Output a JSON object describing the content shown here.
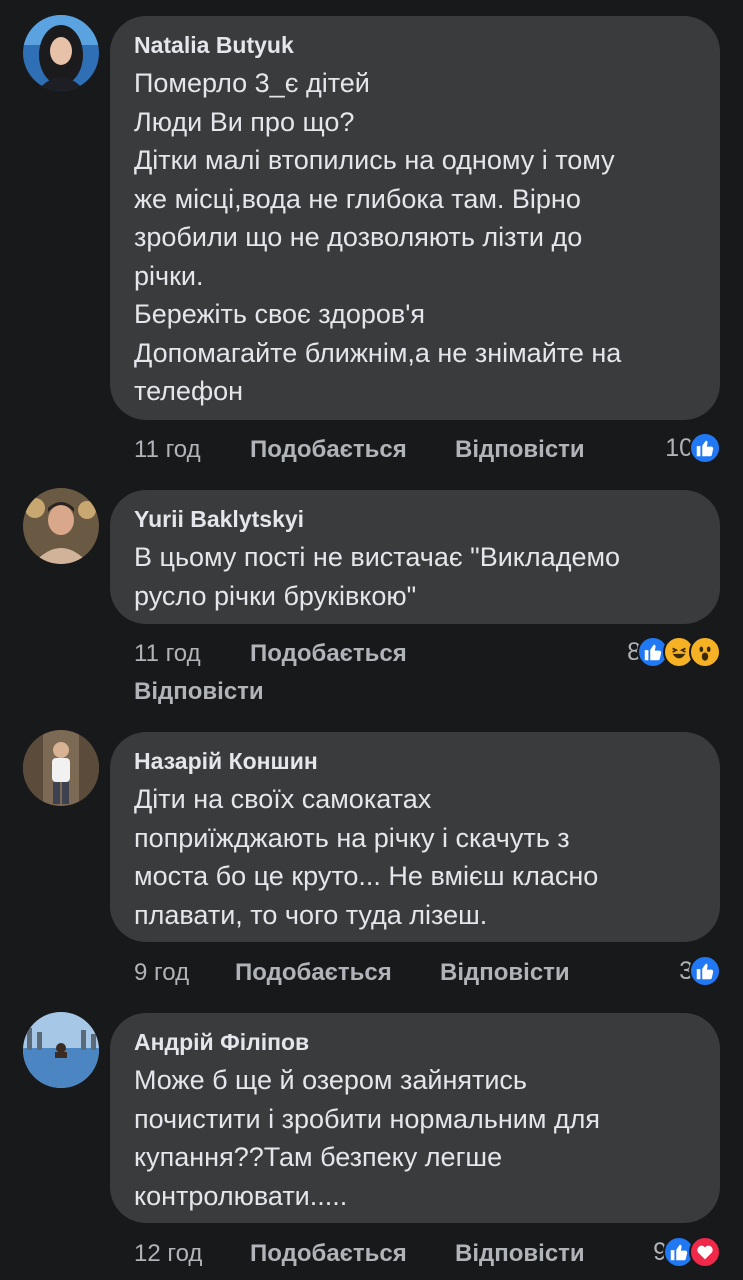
{
  "comments": [
    {
      "author": "Natalia Butyuk",
      "text": "Померло 3_є дітей\nЛюди Ви про що?\nДітки малі втопились на одному і тому\nже місці,вода не глибока там. Вірно\nзробили що не дозволяють лізти до\nрічки.\nБережіть своє здоров'я\nДопомагайте ближнім,а не знімайте на\nтелефон",
      "time": "11 год",
      "like_label": "Подобається",
      "reply_label": "Відповісти",
      "reaction_count": "10",
      "reactions": [
        "like-icon"
      ]
    },
    {
      "author": "Yurii Baklytskyi",
      "text": "В цьому пості не вистачає \"Викладемо\nрусло річки бруківкою\"",
      "time": "11 год",
      "like_label": "Подобається",
      "reply_label": "Відповісти",
      "reaction_count": "8",
      "reactions": [
        "like-icon",
        "haha-icon",
        "wow-icon"
      ]
    },
    {
      "author": "Назарій Коншин",
      "text": "Діти на своїх самокатах\nпоприїжджають на річку і скачуть з\nмоста бо це круто... Не вмієш класно\nплавати, то чого туда лізеш.",
      "time": "9 год",
      "like_label": "Подобається",
      "reply_label": "Відповісти",
      "reaction_count": "3",
      "reactions": [
        "like-icon"
      ]
    },
    {
      "author": "Андрій Філіпов",
      "text": "Може б ще й озером зайнятись\nпочистити і зробити нормальним для\nкупання??Там безпеку легше\nконтролювати.....",
      "time": "12 год",
      "like_label": "Подобається",
      "reply_label": "Відповісти",
      "reaction_count": "9",
      "reactions": [
        "like-icon",
        "love-icon"
      ]
    }
  ],
  "colors": {
    "background": "#18191a",
    "bubble": "#3a3b3c",
    "text": "#e4e6eb",
    "secondary_text": "#b0b3b8",
    "like": "#2078f4",
    "love": "#f0284a",
    "haha_wow": "#f7b125"
  }
}
